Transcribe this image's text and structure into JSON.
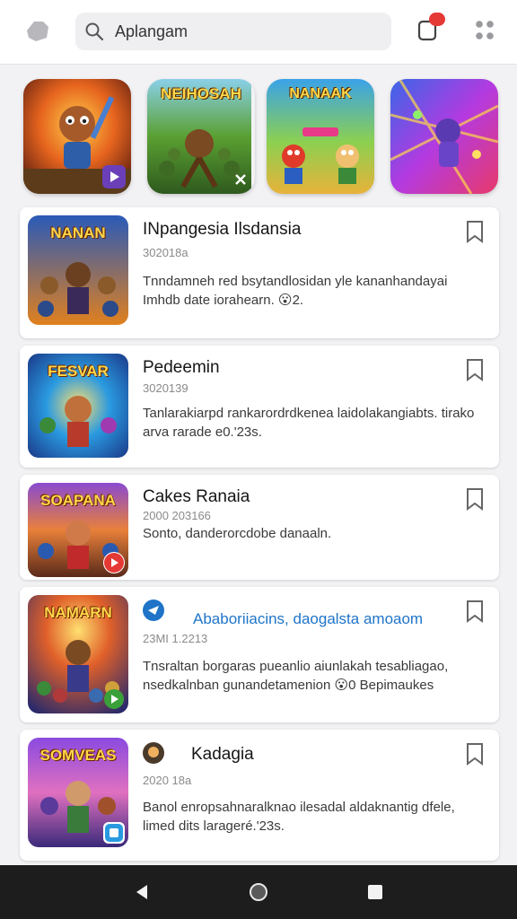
{
  "search": {
    "text": "Aplangam"
  },
  "notification": {
    "badge": ""
  },
  "featured": [
    {
      "label": "",
      "theme": "#d9541e"
    },
    {
      "label": "NEIHOSAH",
      "theme": "#4f8a2f"
    },
    {
      "label": "NANAAK",
      "theme": "#2f8ed8"
    },
    {
      "label": "",
      "theme": "#7c3fd8"
    }
  ],
  "list": [
    {
      "thumb_label": "NANAN",
      "title": "INpangesia Ilsdansia",
      "date": "302018a",
      "description": "Tnndamneh red bsytandlosidan yle kananhandayai Imhdb date iorahearn. 😮2."
    },
    {
      "thumb_label": "FESVAR",
      "title": "Pedeemin",
      "date": "3020139",
      "description": "Tanlarakiarpd rankarordrdkenea laidolakangiabts. tirako arva rarade e0.'23s."
    },
    {
      "thumb_label": "SOAPANA",
      "title": "Cakes Ranaia",
      "date": "2000 203166",
      "description": "Sonto, danderorcdobe danaaln."
    },
    {
      "thumb_label": "NAMARN",
      "title": "Ababoriiacins, daogalsta amoaom",
      "date": "23MI 1.2213",
      "description": "Tnsraltan borgaras pueanlio aiunlakah tesabliagao, nsedkalnban gunandetamenion 😮0 Bepimaukes"
    },
    {
      "thumb_label": "SOMVEAS",
      "title": "Kadagia",
      "date": "2020 18a",
      "description": "Banol enropsahnaralknao ilesadal aldaknantig dfele, limed dits larageré.'23s."
    }
  ]
}
